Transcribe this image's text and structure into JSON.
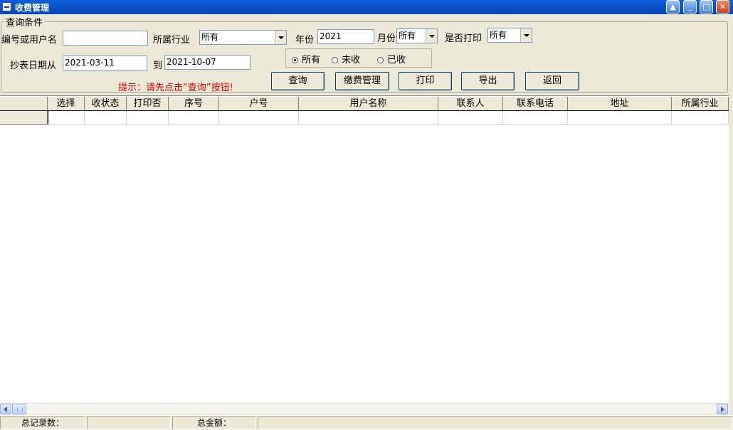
{
  "window": {
    "title": "收费管理",
    "buttons": {
      "help": "▲",
      "minimize": "_",
      "maximize": "□",
      "close": "✕"
    }
  },
  "query": {
    "group_title": "查询条件",
    "user_label": "编号或用户名",
    "user_value": "",
    "industry_label": "所属行业",
    "industry_value": "所有",
    "year_label": "年份",
    "year_value": "2021",
    "month_label": "月份",
    "month_value": "所有",
    "print_label": "是否打印",
    "print_value": "所有",
    "date_from_label": "抄表日期从",
    "date_from": "2021-03-11",
    "date_to_label": "到",
    "date_to": "2021-10-07",
    "radios": [
      {
        "label": "所有",
        "checked": true
      },
      {
        "label": "未收",
        "checked": false
      },
      {
        "label": "已收",
        "checked": false
      }
    ],
    "hint": "提示：请先点击“查询”按钮!"
  },
  "actions": {
    "query": "查询",
    "fee_manage": "缴费管理",
    "print": "打印",
    "export": "导出",
    "back": "返回"
  },
  "grid": {
    "columns": [
      "选择",
      "收状态",
      "打印否",
      "序号",
      "户号",
      "用户名称",
      "联系人",
      "联系电话",
      "地址",
      "所属行业"
    ]
  },
  "status": {
    "total_records_label": "总记录数：",
    "total_records_value": "",
    "total_amount_label": "总金额：",
    "total_amount_value": ""
  }
}
